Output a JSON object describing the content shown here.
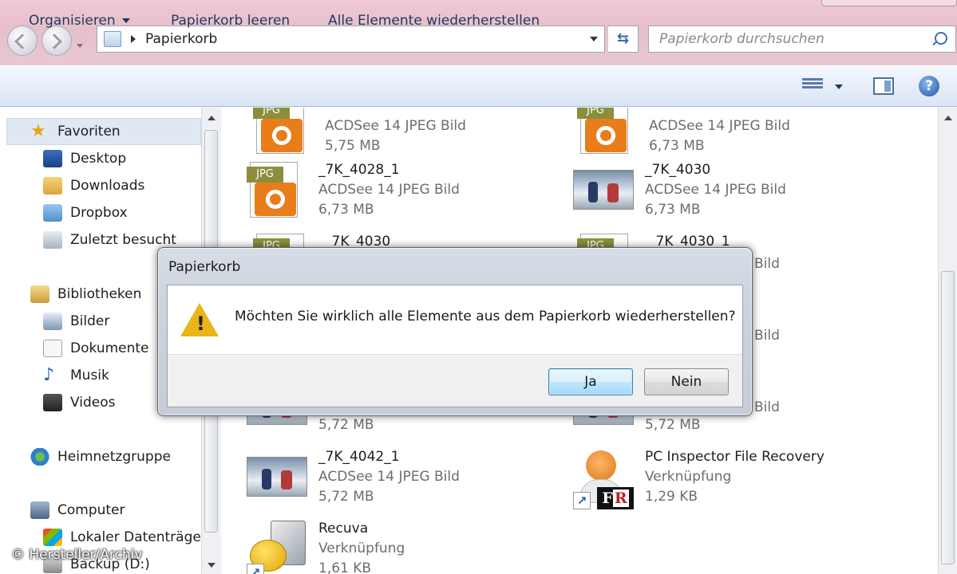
{
  "address": {
    "location": "Papierkorb"
  },
  "search": {
    "placeholder": "Papierkorb durchsuchen"
  },
  "toolbar": {
    "organize": "Organisieren",
    "empty_bin": "Papierkorb leeren",
    "restore_all": "Alle Elemente wiederherstellen"
  },
  "sidebar": {
    "favorites": "Favoriten",
    "desktop": "Desktop",
    "downloads": "Downloads",
    "dropbox": "Dropbox",
    "recent": "Zuletzt besucht",
    "libraries": "Bibliotheken",
    "pictures": "Bilder",
    "documents": "Dokumente",
    "music": "Musik",
    "videos": "Videos",
    "homegroup": "Heimnetzgruppe",
    "computer": "Computer",
    "local_disk": "Lokaler Datenträge",
    "backup": "Backup (D:)"
  },
  "files": [
    {
      "name": "",
      "type": "ACDSee 14 JPEG Bild",
      "size": "5,75 MB"
    },
    {
      "name": "",
      "type": "ACDSee 14 JPEG Bild",
      "size": "6,73 MB"
    },
    {
      "name": "_7K_4028_1",
      "type": "ACDSee 14 JPEG Bild",
      "size": "6,73 MB"
    },
    {
      "name": "_7K_4030",
      "type": "ACDSee 14 JPEG Bild",
      "size": "6,73 MB"
    },
    {
      "name": "_7K_4030",
      "type": "",
      "size": ""
    },
    {
      "name": "_7K_4030_1",
      "type": "Bild",
      "size": ""
    },
    {
      "name": "",
      "type": "Bild",
      "size": ""
    },
    {
      "name": "",
      "type": "Bild",
      "size": "5,72 MB"
    },
    {
      "name": "",
      "type": "",
      "size": "5,72 MB"
    },
    {
      "name": "_7K_4042_1",
      "type": "ACDSee 14 JPEG Bild",
      "size": "5,72 MB"
    },
    {
      "name": "PC Inspector File Recovery",
      "type": "Verknüpfung",
      "size": "1,29 KB"
    },
    {
      "name": "Recuva",
      "type": "Verknüpfung",
      "size": "1,61 KB"
    }
  ],
  "dialog": {
    "title": "Papierkorb",
    "message": "Möchten Sie wirklich alle Elemente aus dem Papierkorb wiederherstellen?",
    "yes": "Ja",
    "no": "Nein"
  },
  "icons": {
    "jpg_tag": "JPG",
    "help": "?",
    "fr_logo_f": "F",
    "fr_logo_r": "R"
  },
  "credit": "© Hersteller/Archiv",
  "colors": {
    "window_frame": "#e6bfcb",
    "command_bar": "#dae5f3",
    "jpg_accent": "#e87d1a",
    "warning": "#e9b518",
    "default_button": "#3c7fb1"
  }
}
